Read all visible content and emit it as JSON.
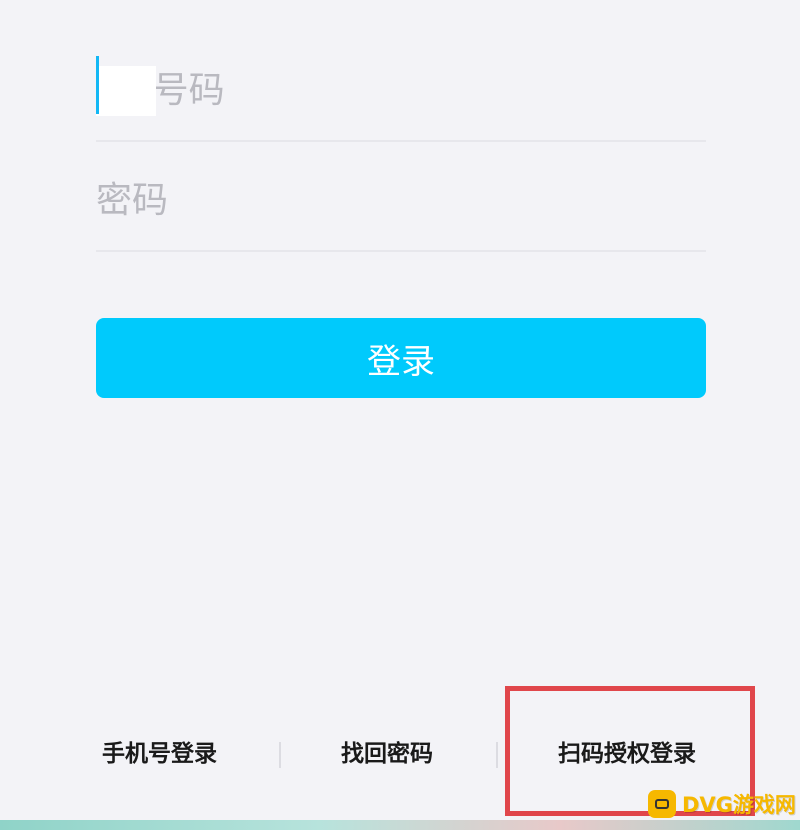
{
  "login_form": {
    "account_placeholder": "QQ号码",
    "password_placeholder": "密码",
    "login_label": "登录"
  },
  "bottom_links": {
    "phone_login": "手机号登录",
    "forgot_password": "找回密码",
    "scan_login": "扫码授权登录"
  },
  "watermark": {
    "text": "DVG游戏网"
  },
  "colors": {
    "accent": "#00cafc",
    "highlight": "#e0464b",
    "background": "#f3f3f7"
  }
}
